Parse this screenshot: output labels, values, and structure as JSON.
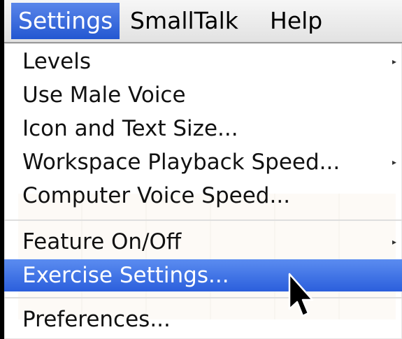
{
  "menubar": {
    "items": [
      {
        "label": "Settings"
      },
      {
        "label": "SmallTalk"
      },
      {
        "label": "Help"
      }
    ]
  },
  "settings_menu": {
    "items": [
      {
        "label": "Levels",
        "has_submenu": true
      },
      {
        "label": "Use Male Voice",
        "has_submenu": false
      },
      {
        "label": "Icon and Text Size...",
        "has_submenu": false
      },
      {
        "label": "Workspace Playback Speed...",
        "has_submenu": true
      },
      {
        "label": "Computer Voice Speed...",
        "has_submenu": false
      },
      {
        "label": "Feature On/Off",
        "has_submenu": true
      },
      {
        "label": "Exercise Settings...",
        "has_submenu": false,
        "highlighted": true
      },
      {
        "label": "Preferences...",
        "has_submenu": false
      }
    ],
    "submenu_arrow_glyph": "▸"
  },
  "colors": {
    "highlight": "#2b5fdc",
    "menubar_active": "#2357d1"
  }
}
